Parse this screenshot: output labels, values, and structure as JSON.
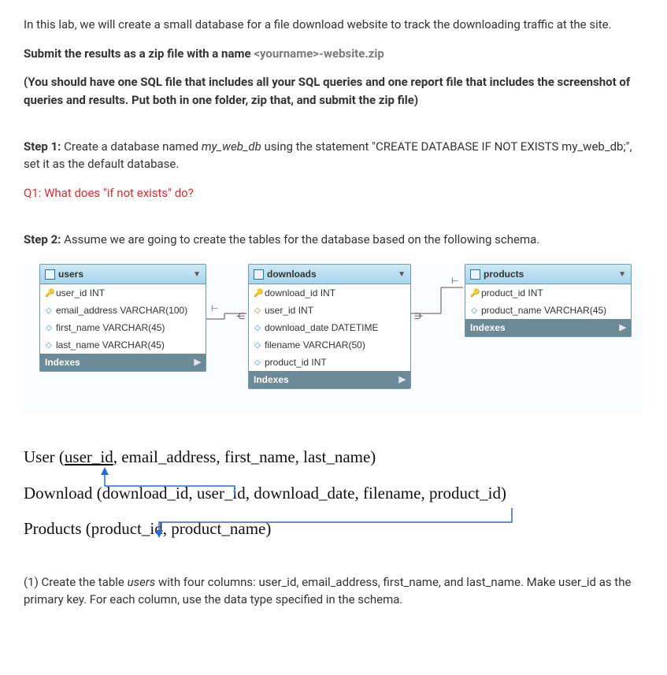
{
  "intro": "In this lab, we will create a small database for a file download website to track the downloading traffic at the site.",
  "submit_line": {
    "prefix": "Submit the results as a zip file with a name ",
    "placeholder": "<yourname>-website.zip"
  },
  "paren_note": "(You should have one SQL file that includes all your SQL queries and one report file that includes the screenshot of queries and results. Put both in one folder, zip that, and submit the zip file)",
  "step1": {
    "label": "Step 1: ",
    "pre": "Create a database named ",
    "db": "my_web_db",
    "mid": " using the statement \"CREATE DATABASE IF NOT EXISTS my_web_db;\", set it as the default database."
  },
  "q1": "Q1: What does \"if not exists\" do?",
  "step2": {
    "label": "Step 2: ",
    "text": "Assume we are going to create the tables for the database based on the following schema."
  },
  "schema": {
    "users": {
      "title": "users",
      "cols": [
        {
          "icon": "key",
          "text": "user_id INT"
        },
        {
          "icon": "dia",
          "text": "email_address VARCHAR(100)"
        },
        {
          "icon": "dia",
          "text": "first_name VARCHAR(45)"
        },
        {
          "icon": "dia",
          "text": "last_name VARCHAR(45)"
        }
      ],
      "indexes": "Indexes"
    },
    "downloads": {
      "title": "downloads",
      "cols": [
        {
          "icon": "key",
          "text": "download_id INT"
        },
        {
          "icon": "diaf",
          "text": "user_id INT"
        },
        {
          "icon": "dia",
          "text": "download_date DATETIME"
        },
        {
          "icon": "dia",
          "text": "filename VARCHAR(50)"
        },
        {
          "icon": "dia",
          "text": "product_id INT"
        }
      ],
      "indexes": "Indexes"
    },
    "products": {
      "title": "products",
      "cols": [
        {
          "icon": "key",
          "text": "product_id INT"
        },
        {
          "icon": "dia",
          "text": "product_name VARCHAR(45)"
        }
      ],
      "indexes": "Indexes"
    }
  },
  "relational_text": {
    "user": {
      "entity": "User",
      "pk": "user_id",
      "rest": ", email_address, first_name, last_name)"
    },
    "download": {
      "entity": "Download",
      "text": "Download (download_id, user_id, download_date, filename, product_id)"
    },
    "products": {
      "entity": "Products",
      "text": "Products (product_id, product_name)"
    }
  },
  "part1": "(1) Create the table users with four columns: user_id, email_address, first_name, and last_name. Make user_id as the primary key. For each column, use the data type specified in the schema.",
  "part1_italic": "users"
}
